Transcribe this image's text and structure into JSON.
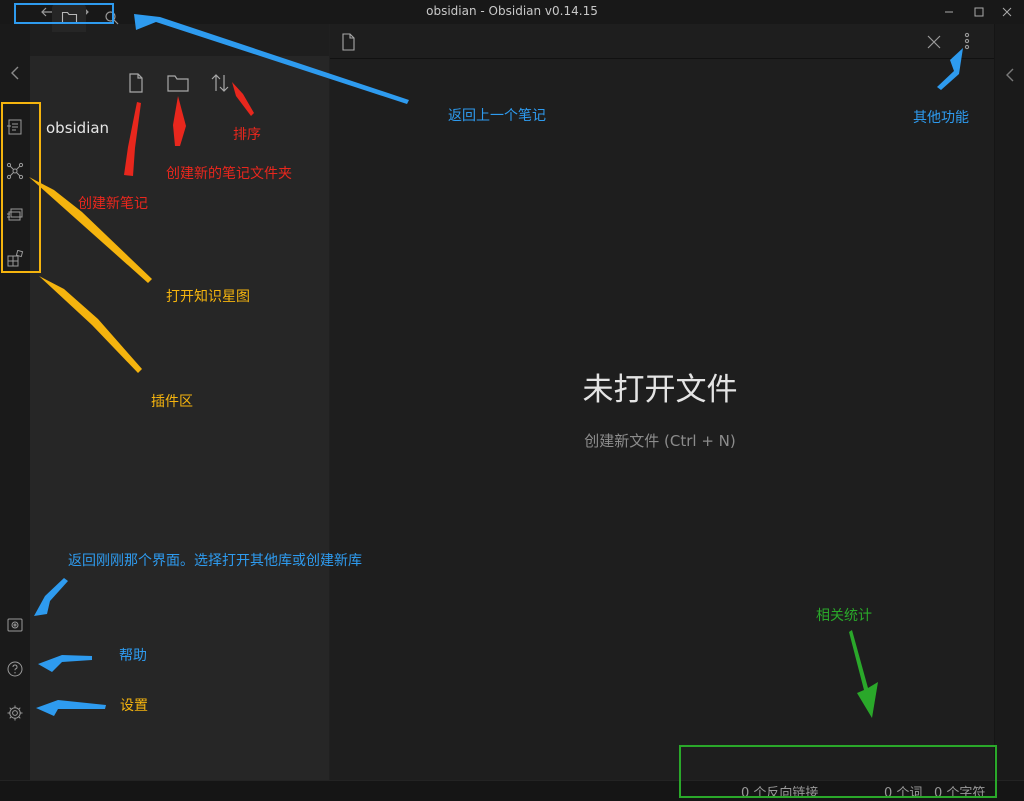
{
  "window": {
    "title": "obsidian - Obsidian v0.14.15"
  },
  "titlebar": {
    "back_icon": "arrow-left-icon",
    "forward_icon": "arrow-right-icon",
    "controls": [
      "minimize-icon",
      "maximize-icon",
      "close-icon"
    ]
  },
  "ribbon": {
    "icons": [
      "quick-switcher-icon",
      "graph-view-icon",
      "slides-icon",
      "plugin-grid-icon"
    ],
    "bottom_icons": [
      "vault-switcher-icon",
      "help-icon",
      "settings-icon"
    ]
  },
  "file_pane": {
    "tabs": [
      "folder-icon",
      "search-icon"
    ],
    "toolbar": [
      "new-note-icon",
      "new-folder-icon",
      "sort-icon"
    ],
    "vault_name": "obsidian"
  },
  "editor": {
    "empty_title": "未打开文件",
    "empty_hint": "创建新文件 (Ctrl + N)"
  },
  "status_bar": {
    "backlinks": "0 个反向链接",
    "words": "0 个词",
    "characters": "0 个字符"
  },
  "annotations": {
    "back_to_prev_note": "返回上一个笔记",
    "more_functions": "其他功能",
    "sort": "排序",
    "new_folder": "创建新的笔记文件夹",
    "new_note": "创建新笔记",
    "open_graph": "打开知识星图",
    "plugin_area": "插件区",
    "back_to_vault_screen": "返回刚刚那个界面。选择打开其他库或创建新库",
    "help": "帮助",
    "settings": "设置",
    "statistics": "相关统计"
  },
  "colors": {
    "annotation_blue": "#2e9bef",
    "annotation_red": "#e8271d",
    "annotation_yellow": "#f5b40e",
    "annotation_green": "#2aa82a"
  }
}
